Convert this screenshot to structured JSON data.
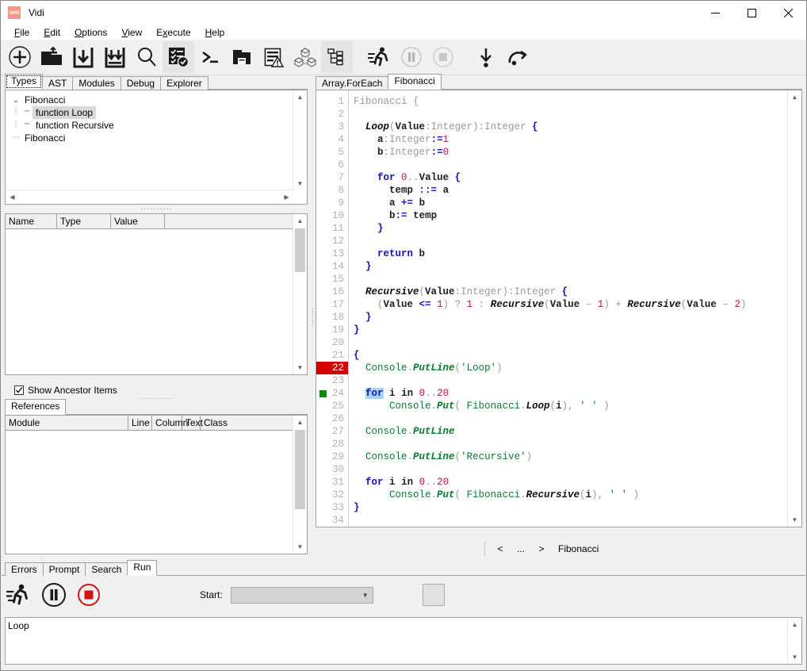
{
  "window": {
    "title": "Vidi",
    "icon_label": "vvv",
    "controls": {
      "minimize": "minimize-icon",
      "maximize": "maximize-icon",
      "close": "close-icon"
    }
  },
  "menu": {
    "items": [
      {
        "label": "File",
        "accel": "F"
      },
      {
        "label": "Edit",
        "accel": "E"
      },
      {
        "label": "Options",
        "accel": "O"
      },
      {
        "label": "View",
        "accel": "V"
      },
      {
        "label": "Execute",
        "accel": "x"
      },
      {
        "label": "Help",
        "accel": "H"
      }
    ]
  },
  "toolbar": {
    "buttons": [
      {
        "name": "new-icon",
        "title": "New"
      },
      {
        "name": "open-folder-icon",
        "title": "Open"
      },
      {
        "name": "save-icon",
        "title": "Save"
      },
      {
        "name": "save-all-icon",
        "title": "Save All"
      },
      {
        "name": "search-icon",
        "title": "Search"
      },
      {
        "name": "checklist-check-icon",
        "title": "Compile",
        "selected": true
      },
      {
        "name": "terminal-icon",
        "title": "Console"
      },
      {
        "name": "archive-icon",
        "title": "Package"
      },
      {
        "name": "document-warning-icon",
        "title": "Errors"
      },
      {
        "name": "modules-graph-icon",
        "title": "Modules"
      },
      {
        "name": "tree-structure-icon",
        "title": "Structure"
      },
      {
        "name": "run-icon",
        "title": "Run"
      },
      {
        "name": "pause-icon",
        "title": "Pause"
      },
      {
        "name": "stop-icon",
        "title": "Stop"
      },
      {
        "name": "step-into-icon",
        "title": "Step Into"
      },
      {
        "name": "step-over-icon",
        "title": "Step Over"
      }
    ]
  },
  "left_panel": {
    "tabs": [
      {
        "label": "Types",
        "active": true
      },
      {
        "label": "AST",
        "active": false
      },
      {
        "label": "Modules",
        "active": false
      },
      {
        "label": "Debug",
        "active": false
      },
      {
        "label": "Explorer",
        "active": false
      }
    ],
    "tree": [
      {
        "label": "Fibonacci",
        "depth": 0,
        "expanded": true,
        "selected": false
      },
      {
        "label": "function Loop",
        "depth": 1,
        "selected": true
      },
      {
        "label": "function Recursive",
        "depth": 1,
        "selected": false
      },
      {
        "label": "Fibonacci",
        "depth": 0,
        "selected": false
      }
    ],
    "variables_grid": {
      "columns": [
        "Name",
        "Type",
        "Value",
        ""
      ],
      "rows": []
    },
    "show_ancestor_items": {
      "label": "Show Ancestor Items",
      "checked": true
    },
    "references_tabs": [
      {
        "label": "References",
        "active": true
      }
    ],
    "references_grid": {
      "columns": [
        "Module",
        "Line",
        "Column",
        "Text",
        "Class"
      ],
      "rows": []
    }
  },
  "editor": {
    "tabs": [
      {
        "label": "Array.ForEach",
        "active": false
      },
      {
        "label": "Fibonacci",
        "active": true
      }
    ],
    "first_line": 1,
    "lines": [
      {
        "n": 1,
        "marker": "none",
        "tokens": [
          {
            "t": "Fibonacci {",
            "c": "dim"
          }
        ]
      },
      {
        "n": 2,
        "marker": "none",
        "tokens": []
      },
      {
        "n": 3,
        "marker": "none",
        "tokens": [
          {
            "t": "  ",
            "c": ""
          },
          {
            "t": "Loop",
            "c": "fn"
          },
          {
            "t": "(",
            "c": "dim"
          },
          {
            "t": "Value",
            "c": "id"
          },
          {
            "t": ":",
            "c": "dim"
          },
          {
            "t": "Integer",
            "c": "typ"
          },
          {
            "t": ")",
            "c": "dim"
          },
          {
            "t": ":",
            "c": "dim"
          },
          {
            "t": "Integer",
            "c": "typ"
          },
          {
            "t": " ",
            "c": ""
          },
          {
            "t": "{",
            "c": "k"
          }
        ]
      },
      {
        "n": 4,
        "marker": "none",
        "tokens": [
          {
            "t": "    ",
            "c": ""
          },
          {
            "t": "a",
            "c": "id"
          },
          {
            "t": ":",
            "c": "dim"
          },
          {
            "t": "Integer",
            "c": "typ"
          },
          {
            "t": ":=",
            "c": "k"
          },
          {
            "t": "1",
            "c": "num"
          }
        ]
      },
      {
        "n": 5,
        "marker": "none",
        "tokens": [
          {
            "t": "    ",
            "c": ""
          },
          {
            "t": "b",
            "c": "id"
          },
          {
            "t": ":",
            "c": "dim"
          },
          {
            "t": "Integer",
            "c": "typ"
          },
          {
            "t": ":=",
            "c": "k"
          },
          {
            "t": "0",
            "c": "num"
          }
        ]
      },
      {
        "n": 6,
        "marker": "none",
        "tokens": []
      },
      {
        "n": 7,
        "marker": "none",
        "tokens": [
          {
            "t": "    ",
            "c": ""
          },
          {
            "t": "for",
            "c": "k"
          },
          {
            "t": " ",
            "c": ""
          },
          {
            "t": "0",
            "c": "num"
          },
          {
            "t": "..",
            "c": "dim"
          },
          {
            "t": "Value",
            "c": "id"
          },
          {
            "t": " ",
            "c": ""
          },
          {
            "t": "{",
            "c": "k"
          }
        ]
      },
      {
        "n": 8,
        "marker": "none",
        "tokens": [
          {
            "t": "      ",
            "c": ""
          },
          {
            "t": "temp",
            "c": "id"
          },
          {
            "t": " ",
            "c": ""
          },
          {
            "t": "::=",
            "c": "k"
          },
          {
            "t": " ",
            "c": ""
          },
          {
            "t": "a",
            "c": "id"
          }
        ]
      },
      {
        "n": 9,
        "marker": "none",
        "tokens": [
          {
            "t": "      ",
            "c": ""
          },
          {
            "t": "a",
            "c": "id"
          },
          {
            "t": " ",
            "c": ""
          },
          {
            "t": "+=",
            "c": "k"
          },
          {
            "t": " ",
            "c": ""
          },
          {
            "t": "b",
            "c": "id"
          }
        ]
      },
      {
        "n": 10,
        "marker": "none",
        "tokens": [
          {
            "t": "      ",
            "c": ""
          },
          {
            "t": "b",
            "c": "id"
          },
          {
            "t": ":=",
            "c": "k"
          },
          {
            "t": " ",
            "c": ""
          },
          {
            "t": "temp",
            "c": "id"
          }
        ]
      },
      {
        "n": 11,
        "marker": "none",
        "tokens": [
          {
            "t": "    ",
            "c": ""
          },
          {
            "t": "}",
            "c": "k"
          }
        ]
      },
      {
        "n": 12,
        "marker": "none",
        "tokens": []
      },
      {
        "n": 13,
        "marker": "none",
        "tokens": [
          {
            "t": "    ",
            "c": ""
          },
          {
            "t": "return",
            "c": "k"
          },
          {
            "t": " ",
            "c": ""
          },
          {
            "t": "b",
            "c": "id"
          }
        ]
      },
      {
        "n": 14,
        "marker": "none",
        "tokens": [
          {
            "t": "  ",
            "c": ""
          },
          {
            "t": "}",
            "c": "k"
          }
        ]
      },
      {
        "n": 15,
        "marker": "none",
        "tokens": []
      },
      {
        "n": 16,
        "marker": "none",
        "tokens": [
          {
            "t": "  ",
            "c": ""
          },
          {
            "t": "Recursive",
            "c": "fn"
          },
          {
            "t": "(",
            "c": "dim"
          },
          {
            "t": "Value",
            "c": "id"
          },
          {
            "t": ":",
            "c": "dim"
          },
          {
            "t": "Integer",
            "c": "typ"
          },
          {
            "t": ")",
            "c": "dim"
          },
          {
            "t": ":",
            "c": "dim"
          },
          {
            "t": "Integer",
            "c": "typ"
          },
          {
            "t": " ",
            "c": ""
          },
          {
            "t": "{",
            "c": "k"
          }
        ]
      },
      {
        "n": 17,
        "marker": "none",
        "tokens": [
          {
            "t": "    ",
            "c": ""
          },
          {
            "t": "(",
            "c": "dim"
          },
          {
            "t": "Value",
            "c": "id"
          },
          {
            "t": " ",
            "c": ""
          },
          {
            "t": "<=",
            "c": "k"
          },
          {
            "t": " ",
            "c": ""
          },
          {
            "t": "1",
            "c": "num"
          },
          {
            "t": ")",
            "c": "dim"
          },
          {
            "t": " ",
            "c": ""
          },
          {
            "t": "?",
            "c": "dim"
          },
          {
            "t": " ",
            "c": ""
          },
          {
            "t": "1",
            "c": "num"
          },
          {
            "t": " ",
            "c": ""
          },
          {
            "t": ":",
            "c": "dim"
          },
          {
            "t": " ",
            "c": ""
          },
          {
            "t": "Recursive",
            "c": "fn"
          },
          {
            "t": "(",
            "c": "dim"
          },
          {
            "t": "Value",
            "c": "id"
          },
          {
            "t": " ",
            "c": ""
          },
          {
            "t": "–",
            "c": "dim"
          },
          {
            "t": " ",
            "c": ""
          },
          {
            "t": "1",
            "c": "num"
          },
          {
            "t": ")",
            "c": "dim"
          },
          {
            "t": " + ",
            "c": "dim"
          },
          {
            "t": "Recursive",
            "c": "fn"
          },
          {
            "t": "(",
            "c": "dim"
          },
          {
            "t": "Value",
            "c": "id"
          },
          {
            "t": " ",
            "c": ""
          },
          {
            "t": "–",
            "c": "dim"
          },
          {
            "t": " ",
            "c": ""
          },
          {
            "t": "2",
            "c": "num"
          },
          {
            "t": ")",
            "c": "dim"
          }
        ]
      },
      {
        "n": 18,
        "marker": "none",
        "tokens": [
          {
            "t": "  ",
            "c": ""
          },
          {
            "t": "}",
            "c": "k"
          }
        ]
      },
      {
        "n": 19,
        "marker": "none",
        "tokens": [
          {
            "t": "}",
            "c": "k"
          }
        ]
      },
      {
        "n": 20,
        "marker": "none",
        "tokens": []
      },
      {
        "n": 21,
        "marker": "none",
        "tokens": [
          {
            "t": "{",
            "c": "k"
          }
        ]
      },
      {
        "n": 22,
        "marker": "breakpoint",
        "tokens": [
          {
            "t": "  ",
            "c": ""
          },
          {
            "t": "Console",
            "c": "ns"
          },
          {
            "t": ".",
            "c": "dim"
          },
          {
            "t": "PutLine",
            "c": "fnb"
          },
          {
            "t": "(",
            "c": "dim"
          },
          {
            "t": "'Loop'",
            "c": "str"
          },
          {
            "t": ")",
            "c": "dim"
          }
        ]
      },
      {
        "n": 23,
        "marker": "none",
        "tokens": []
      },
      {
        "n": 24,
        "marker": "current",
        "tokens": [
          {
            "t": "  ",
            "c": ""
          },
          {
            "t": "for",
            "c": "k selhl"
          },
          {
            "t": " ",
            "c": ""
          },
          {
            "t": "i",
            "c": "id"
          },
          {
            "t": " ",
            "c": ""
          },
          {
            "t": "in",
            "c": "id"
          },
          {
            "t": " ",
            "c": ""
          },
          {
            "t": "0",
            "c": "num"
          },
          {
            "t": "..",
            "c": "dim"
          },
          {
            "t": "20",
            "c": "num"
          }
        ]
      },
      {
        "n": 25,
        "marker": "none",
        "tokens": [
          {
            "t": "      ",
            "c": ""
          },
          {
            "t": "Console",
            "c": "ns"
          },
          {
            "t": ".",
            "c": "dim"
          },
          {
            "t": "Put",
            "c": "fnb"
          },
          {
            "t": "( ",
            "c": "dim"
          },
          {
            "t": "Fibonacci",
            "c": "ns"
          },
          {
            "t": ".",
            "c": "dim"
          },
          {
            "t": "Loop",
            "c": "fn"
          },
          {
            "t": "(",
            "c": "dim"
          },
          {
            "t": "i",
            "c": "id"
          },
          {
            "t": "), ",
            "c": "dim"
          },
          {
            "t": "' '",
            "c": "str"
          },
          {
            "t": " )",
            "c": "dim"
          }
        ]
      },
      {
        "n": 26,
        "marker": "none",
        "tokens": []
      },
      {
        "n": 27,
        "marker": "none",
        "tokens": [
          {
            "t": "  ",
            "c": ""
          },
          {
            "t": "Console",
            "c": "ns"
          },
          {
            "t": ".",
            "c": "dim"
          },
          {
            "t": "PutLine",
            "c": "fnb"
          }
        ]
      },
      {
        "n": 28,
        "marker": "none",
        "tokens": []
      },
      {
        "n": 29,
        "marker": "none",
        "tokens": [
          {
            "t": "  ",
            "c": ""
          },
          {
            "t": "Console",
            "c": "ns"
          },
          {
            "t": ".",
            "c": "dim"
          },
          {
            "t": "PutLine",
            "c": "fnb"
          },
          {
            "t": "(",
            "c": "dim"
          },
          {
            "t": "'Recursive'",
            "c": "str"
          },
          {
            "t": ")",
            "c": "dim"
          }
        ]
      },
      {
        "n": 30,
        "marker": "none",
        "tokens": []
      },
      {
        "n": 31,
        "marker": "none",
        "tokens": [
          {
            "t": "  ",
            "c": ""
          },
          {
            "t": "for",
            "c": "k"
          },
          {
            "t": " ",
            "c": ""
          },
          {
            "t": "i",
            "c": "id"
          },
          {
            "t": " ",
            "c": ""
          },
          {
            "t": "in",
            "c": "id"
          },
          {
            "t": " ",
            "c": ""
          },
          {
            "t": "0",
            "c": "num"
          },
          {
            "t": "..",
            "c": "dim"
          },
          {
            "t": "20",
            "c": "num"
          }
        ]
      },
      {
        "n": 32,
        "marker": "none",
        "tokens": [
          {
            "t": "      ",
            "c": ""
          },
          {
            "t": "Console",
            "c": "ns"
          },
          {
            "t": ".",
            "c": "dim"
          },
          {
            "t": "Put",
            "c": "fnb"
          },
          {
            "t": "( ",
            "c": "dim"
          },
          {
            "t": "Fibonacci",
            "c": "ns"
          },
          {
            "t": ".",
            "c": "dim"
          },
          {
            "t": "Recursive",
            "c": "fn"
          },
          {
            "t": "(",
            "c": "dim"
          },
          {
            "t": "i",
            "c": "id"
          },
          {
            "t": "), ",
            "c": "dim"
          },
          {
            "t": "' '",
            "c": "str"
          },
          {
            "t": " )",
            "c": "dim"
          }
        ]
      },
      {
        "n": 33,
        "marker": "none",
        "tokens": [
          {
            "t": "}",
            "c": "k"
          }
        ]
      },
      {
        "n": 34,
        "marker": "none",
        "tokens": []
      }
    ],
    "nav": {
      "prev": "<",
      "more": "...",
      "next": ">",
      "current": "Fibonacci"
    }
  },
  "bottom_panel": {
    "tabs": [
      {
        "label": "Errors",
        "active": false
      },
      {
        "label": "Prompt",
        "active": false
      },
      {
        "label": "Search",
        "active": false
      },
      {
        "label": "Run",
        "active": true
      }
    ],
    "run_controls": [
      {
        "name": "run-icon",
        "title": "Run"
      },
      {
        "name": "pause-icon",
        "title": "Pause"
      },
      {
        "name": "stop-icon",
        "title": "Stop"
      }
    ],
    "start_label": "Start:",
    "start_value": "",
    "output": "Loop"
  },
  "colors": {
    "breakpoint_red": "#d60000",
    "current_line_green": "#0a8a0a",
    "keyword_blue": "#1414b4",
    "number_crimson": "#b0135a",
    "string_green": "#0b7a30",
    "selection_blue": "#a8d4f5",
    "accent_icon": "#f4998a"
  }
}
